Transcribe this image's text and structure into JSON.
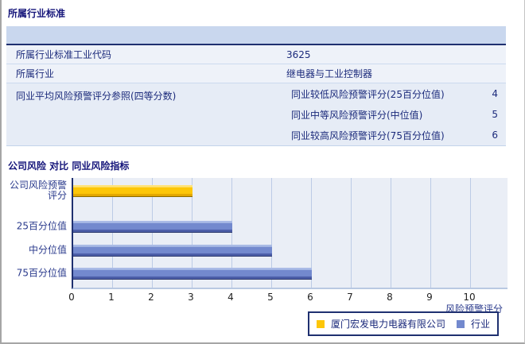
{
  "page": {
    "section1_title": "所属行业标准",
    "section2_title": "公司风险 对比 同业风险指标"
  },
  "table": {
    "rows": [
      {
        "label": "所属行业标准工业代码",
        "value": "3625"
      },
      {
        "label": "所属行业",
        "value": "继电器与工业控制器"
      }
    ],
    "quartile_row": {
      "label": "同业平均风险预警评分参照(四等分数)",
      "items": [
        {
          "label": "同业较低风险预警评分(25百分位值)",
          "value": "4"
        },
        {
          "label": "同业中等风险预警评分(中位值)",
          "value": "5"
        },
        {
          "label": "同业较高风险预警评分(75百分位值)",
          "value": "6"
        }
      ]
    }
  },
  "chart_data": {
    "type": "bar",
    "orientation": "horizontal",
    "title": "公司风险 对比 同业风险指标",
    "categories": [
      "公司风险预警评分",
      "25百分位值",
      "中分位值",
      "75百分位值"
    ],
    "series": [
      {
        "name": "厦门宏发电力电器有限公司",
        "values": [
          3,
          null,
          null,
          null
        ]
      },
      {
        "name": "行业",
        "values": [
          null,
          4,
          5,
          6
        ]
      }
    ],
    "xlabel": "风险预警评分",
    "xlim": [
      0,
      11
    ],
    "xticks": [
      0,
      1,
      2,
      3,
      4,
      5,
      6,
      7,
      8,
      9,
      10
    ],
    "grid": true,
    "legend_position": "bottom-right",
    "colors": {
      "plot_bg": "#eaeef6",
      "gridline": "#bccbe6",
      "series_styles": [
        {
          "top": "#ffe37a",
          "mid": "#fdc608",
          "bottom": "#e2a600",
          "border": "#8a6a00"
        },
        {
          "top": "#aabbe6",
          "mid": "#7389ce",
          "bottom": "#4a5ca6",
          "border": "#2e3a6e"
        }
      ]
    }
  }
}
